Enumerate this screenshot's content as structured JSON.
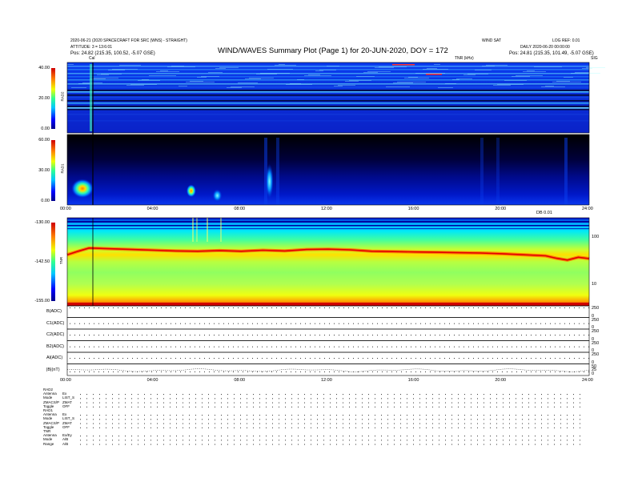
{
  "header": {
    "title": "WIND/WAVES Summary Plot (Page 1) for 20-JUN-2020, DOY = 172",
    "left_line1": "2020-06-21 (2020 SPACECRAFT FOR SRC (WNS) - STRAIGHT)",
    "left_line2": "ATTITUDE: 3 = 13:6:01",
    "left_line3": "Pos:   24.82 (215.35, 100.52, -5.07 GSE)",
    "right_top": "WIND SAT",
    "right_top2": "LOG REF: 0.01",
    "right_line2": "DAILY 2020-06-20 00:00:00",
    "right_line3": "Pos:   24.81 (215.35, 101.49, -5.07 GSE)",
    "tnr_label": "TNR (kHz)",
    "right_small": "SIG",
    "cal_marker": "Cal"
  },
  "chart_data": [
    {
      "type": "heatmap",
      "ylabel": "RAD2",
      "yticks": [
        "0.00",
        "20.00",
        "40.00"
      ],
      "ylim": [
        0,
        40
      ]
    },
    {
      "type": "heatmap",
      "ylabel": "RAD1",
      "yticks": [
        "0.00",
        "30.00",
        "60.00"
      ],
      "ylim": [
        0,
        60
      ],
      "xticks": [
        "00:00",
        "04:00",
        "08:00",
        "12:00",
        "16:00",
        "20:00",
        "24:00"
      ],
      "bright_features": [
        {
          "t": 0.7,
          "f": 14
        },
        {
          "t": 5.7,
          "f": 12
        },
        {
          "t": 6.9,
          "f": 8
        },
        {
          "t": 9.3,
          "f": 20
        }
      ]
    },
    {
      "type": "heatmap",
      "ylabel": "TNR",
      "yticks": [
        "-155.00",
        "-142.50",
        "-130.00"
      ],
      "ylim": [
        -155,
        -130
      ],
      "right_ticks": [
        "100",
        "10"
      ],
      "right_label": "DB 0.01",
      "plasma_line_t": [
        0,
        0.5,
        1,
        2,
        3,
        4,
        5,
        6,
        7,
        8,
        9,
        10,
        11,
        12,
        13,
        14,
        15,
        16,
        17,
        18,
        19,
        20,
        21,
        22,
        22.5,
        23,
        23.5,
        24
      ],
      "plasma_line_v": [
        -140.5,
        -139.5,
        -138.6,
        -138.8,
        -139.0,
        -139.2,
        -139.4,
        -139.5,
        -139.3,
        -139.5,
        -139.2,
        -139.4,
        -139.0,
        -138.9,
        -139.1,
        -139.5,
        -139.6,
        -139.7,
        -139.8,
        -139.9,
        -140.0,
        -140.2,
        -140.5,
        -140.8,
        -141.5,
        -142.0,
        -141.2,
        -141.6
      ]
    },
    {
      "type": "line",
      "xticks": [
        "00:00",
        "04:00",
        "08:00",
        "12:00",
        "16:00",
        "20:00",
        "24:00"
      ],
      "panels": [
        {
          "label": "B(ADC)",
          "right_ticks": [
            "250",
            "0"
          ],
          "dot_level": 0.85
        },
        {
          "label": "C1(ADC)",
          "right_ticks": [
            "250",
            "0"
          ],
          "dot_level": 0.5
        },
        {
          "label": "C2(ADC)",
          "right_ticks": [
            "250",
            "0"
          ],
          "dot_level": 0.5
        },
        {
          "label": "B2(ADC)",
          "right_ticks": [
            "250",
            "0"
          ],
          "dot_level": 0.5
        },
        {
          "label": "Al(ADC)",
          "right_ticks": [
            "250",
            "0"
          ],
          "dot_level": 0.5
        },
        {
          "label": "|B|(nT)",
          "right_ticks": [
            "50",
            "25",
            "0"
          ],
          "dot_level": 0.35
        }
      ]
    }
  ],
  "footer_rows": [
    {
      "name": "RAD2",
      "value": ""
    },
    {
      "name": "Antenna",
      "value": "Ex"
    },
    {
      "name": "Mode",
      "value": "LIST_S"
    },
    {
      "name": "ZMACS/P",
      "value": "ZMAT"
    },
    {
      "name": "Toggle",
      "value": "OFF"
    },
    {
      "name": "RAD1",
      "value": ""
    },
    {
      "name": "Antenna",
      "value": "Ex"
    },
    {
      "name": "Mode",
      "value": "LIST_S"
    },
    {
      "name": "ZMACS/P",
      "value": "ZMAT"
    },
    {
      "name": "Toggle",
      "value": "OFF"
    },
    {
      "name": "TNR",
      "value": ""
    },
    {
      "name": "Antenna",
      "value": "Ex/Ey"
    },
    {
      "name": "Mode",
      "value": "A/B"
    },
    {
      "name": "Range",
      "value": "A/B"
    }
  ]
}
